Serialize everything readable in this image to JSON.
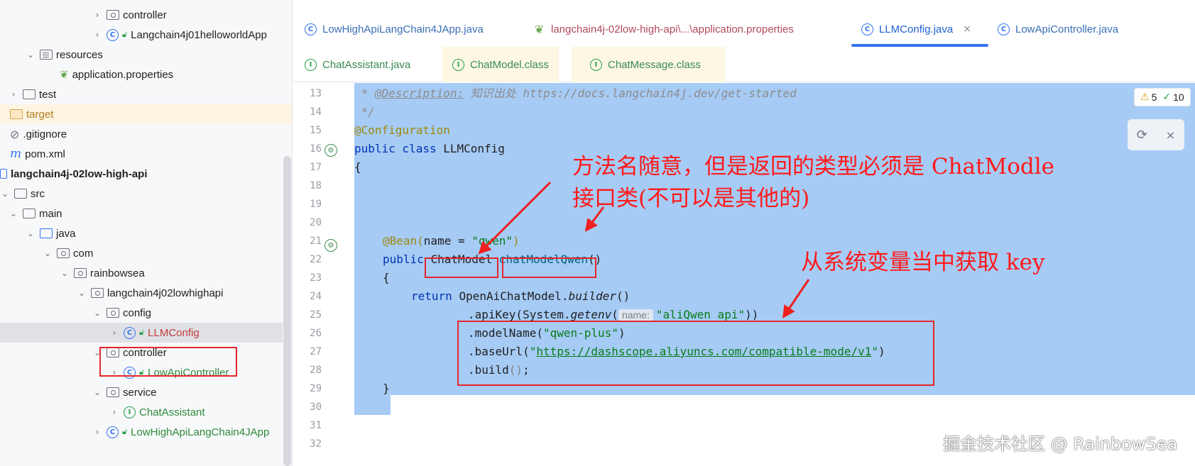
{
  "tree": {
    "items": [
      {
        "label": "controller",
        "chev": "›"
      },
      {
        "label": "Langchain4j01helloworldApp",
        "chev": "›"
      },
      {
        "label": "resources",
        "chev": "⌄"
      },
      {
        "label": "application.properties",
        "chev": ""
      },
      {
        "label": "test",
        "chev": "›"
      },
      {
        "label": "target",
        "chev": ""
      },
      {
        "label": ".gitignore",
        "chev": ""
      },
      {
        "label": "pom.xml",
        "chev": ""
      },
      {
        "label": "langchain4j-02low-high-api",
        "chev": "⌄"
      },
      {
        "label": "src",
        "chev": "⌄"
      },
      {
        "label": "main",
        "chev": "⌄"
      },
      {
        "label": "java",
        "chev": "⌄"
      },
      {
        "label": "com",
        "chev": "⌄"
      },
      {
        "label": "rainbowsea",
        "chev": "⌄"
      },
      {
        "label": "langchain4j02lowhighapi",
        "chev": "⌄"
      },
      {
        "label": "config",
        "chev": "⌄"
      },
      {
        "label": "LLMConfig",
        "chev": "›"
      },
      {
        "label": "controller",
        "chev": "⌄"
      },
      {
        "label": "LowApiController",
        "chev": "›"
      },
      {
        "label": "service",
        "chev": "⌄"
      },
      {
        "label": "ChatAssistant",
        "chev": "›"
      },
      {
        "label": "LowHighApiLangChain4JApp",
        "chev": "›"
      }
    ]
  },
  "tabs": {
    "row1": [
      {
        "label": "LowHighApiLangChain4JApp.java",
        "icon": "C"
      },
      {
        "label": "langchain4j-02low-high-api\\...\\application.properties",
        "icon": "❦"
      },
      {
        "label": "LLMConfig.java",
        "icon": "C",
        "close": "×"
      },
      {
        "label": "LowApiController.java",
        "icon": "C"
      }
    ],
    "row2": [
      {
        "label": "ChatAssistant.java",
        "icon": "I"
      },
      {
        "label": "ChatModel.class",
        "icon": "I"
      },
      {
        "label": "ChatMessage.class",
        "icon": "I"
      }
    ]
  },
  "inspection": {
    "warnings": "5",
    "checks": "10",
    "warn_icon": "⚠",
    "check_icon": "✓"
  },
  "editor": {
    "line_numbers": [
      "13",
      "14",
      "15",
      "16",
      "17",
      "18",
      "19",
      "20",
      "21",
      "22",
      "23",
      "24",
      "25",
      "26",
      "27",
      "28",
      "29",
      "30",
      "31",
      "32"
    ],
    "code": {
      "l13_star": " * ",
      "l13_tag": "@Description:",
      "l13_rest": " 知识出处 https://docs.langchain4j.dev/get-started",
      "l14": " */",
      "l15": "@Configuration",
      "l16_kw": "public class",
      "l16_name": " LLMConfig",
      "l17": "{",
      "l21_ann": "@Bean(",
      "l21_attr": "name = ",
      "l21_str": "\"qwen\"",
      "l21_close": ")",
      "l22_kw": "public ",
      "l22_type": "ChatModel",
      "l22_sp": " ",
      "l22_fn": "chatModelQwen",
      "l22_paren": "()",
      "l23": "{",
      "l24_kw": "return ",
      "l24_cls": "OpenAiChatModel.",
      "l24_fn": "builder",
      "l24_paren": "()",
      "l25_a": ".apiKey(System.",
      "l25_fn": "getenv",
      "l25_paren": "(",
      "l25_hint": "name:",
      "l25_str": "\"aliQwen_api\"",
      "l25_close": "))",
      "l26_a": ".modelName(",
      "l26_str": "\"qwen-plus\"",
      "l26_close": ")",
      "l27_a": ".baseUrl(",
      "l27_q": "\"",
      "l27_url": "https://dashscope.aliyuncs.com/compatible-mode/v1",
      "l27_q2": "\"",
      "l27_close": ")",
      "l28_a": ".build",
      "l28_paren": "()",
      "l28_semi": ";",
      "l29": "}"
    }
  },
  "annotations": {
    "note1_line1": "方法名随意，但是返回的类型必须是 ChatModle",
    "note1_line2": "接口类(不可以是其他的)",
    "note2": "从系统变量当中获取 key"
  },
  "watermark": "掘金技术社区 @ RainbowSea",
  "colors": {
    "accent": "#3574f0",
    "selection": "#a6cbf5",
    "annotation_red": "#ff1a1a"
  },
  "icons": {
    "gutter": "bean-icon",
    "float_close": "×"
  }
}
